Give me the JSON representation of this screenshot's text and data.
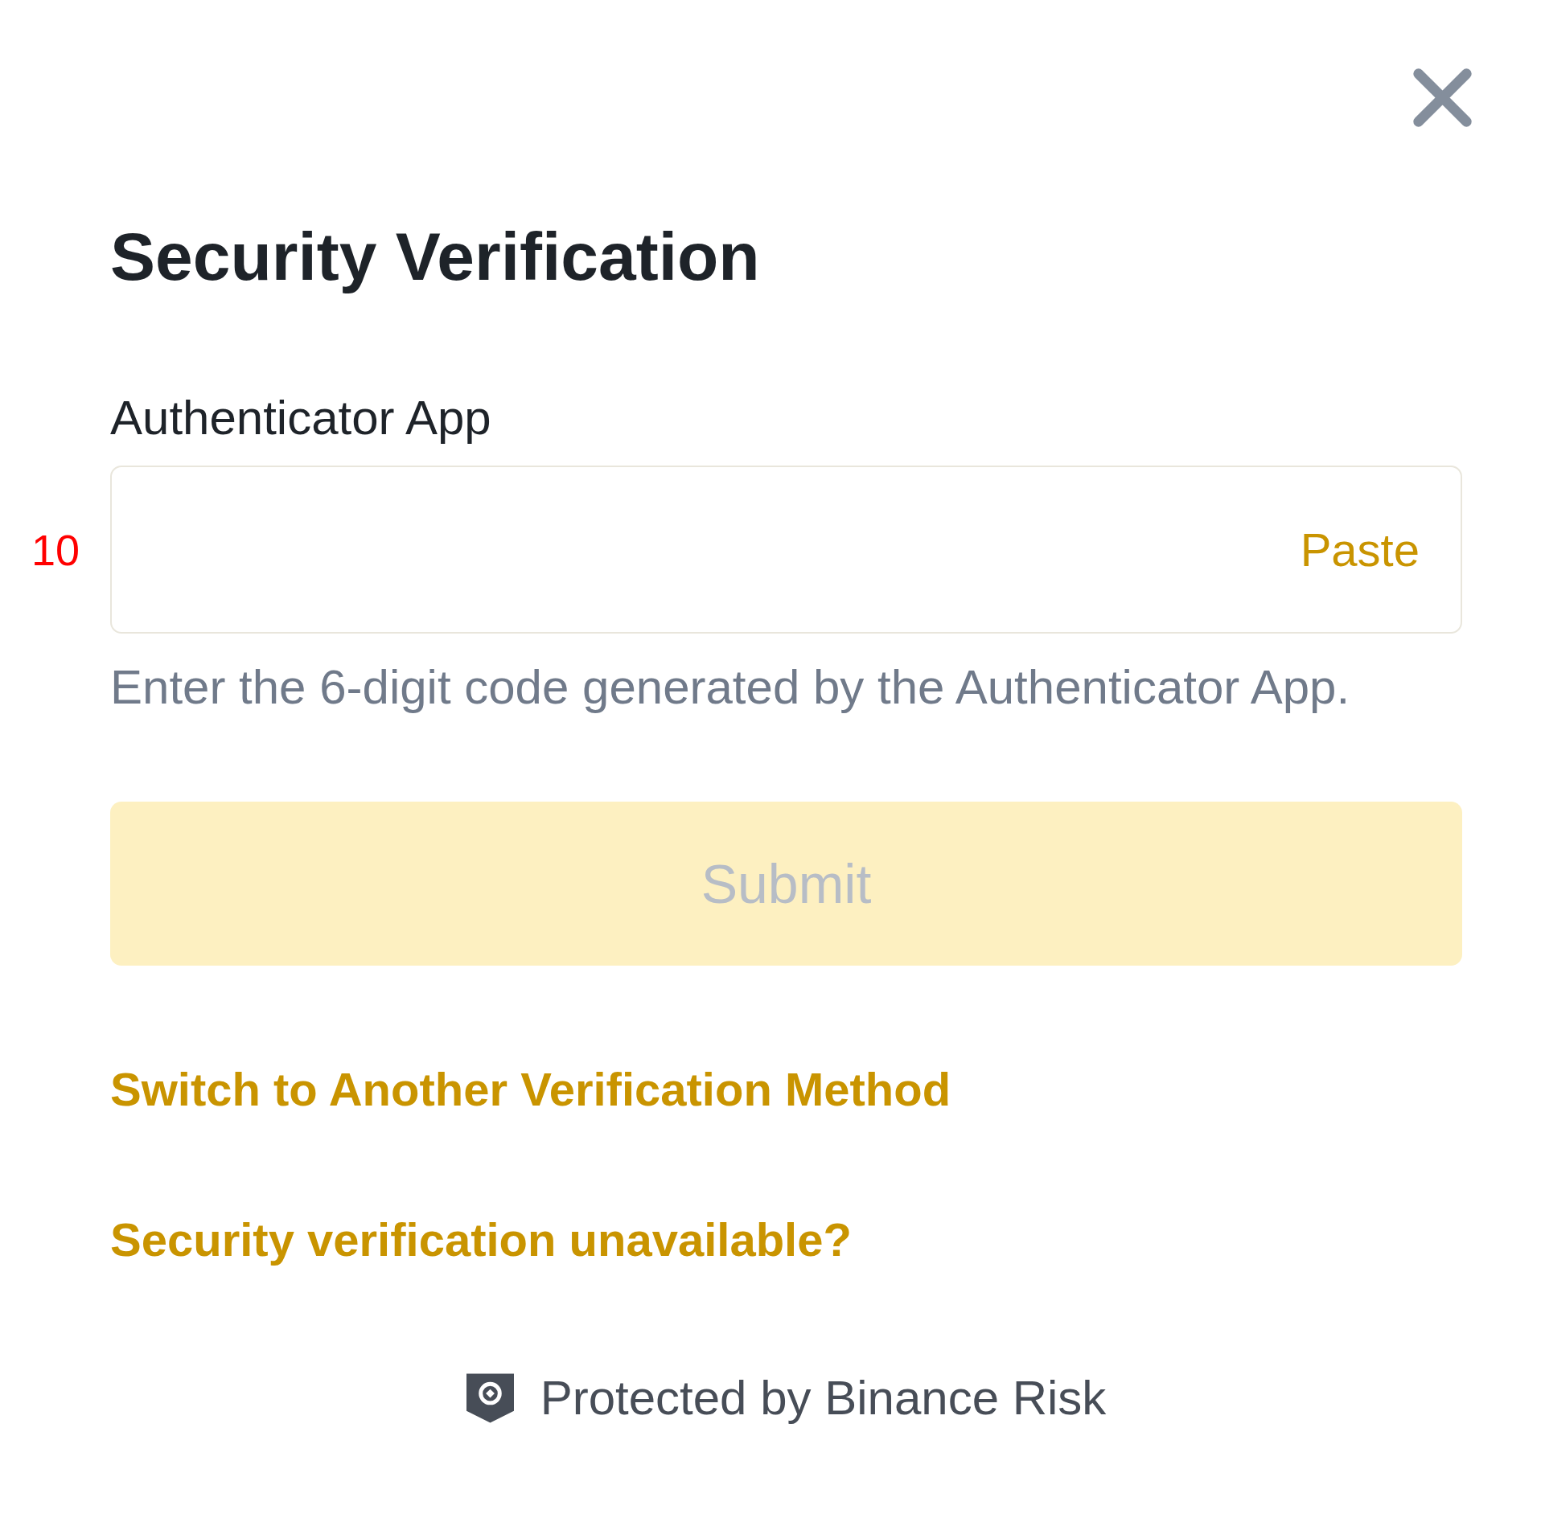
{
  "dialog": {
    "title": "Security Verification"
  },
  "field": {
    "label": "Authenticator App",
    "annotation": "10",
    "paste_button": "Paste",
    "hint": "Enter the 6-digit code generated by the Authenticator App."
  },
  "submit_button": {
    "label": "Submit",
    "disabled": true
  },
  "links": [
    {
      "label": "Switch to Another Verification Method"
    },
    {
      "label": "Security verification unavailable?"
    }
  ],
  "footer": {
    "text": "Protected by Binance Risk"
  }
}
